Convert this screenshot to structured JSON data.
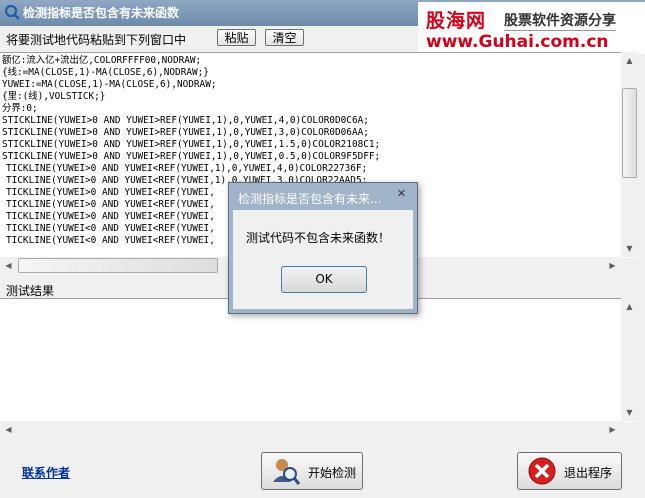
{
  "window": {
    "title": "检测指标是否包含有未来函数"
  },
  "watermark": {
    "name": "股海网",
    "tagline": "股票软件资源分享",
    "url": "www.Guhai.com.cn"
  },
  "top": {
    "paste_label": "将要测试地代码粘贴到下列窗口中",
    "paste_button": "粘贴",
    "clear_button": "清空"
  },
  "code_lines": [
    "额亿:流入亿+流出亿,COLORFFFF00,NODRAW;",
    "{线:=MA(CLOSE,1)-MA(CLOSE,6),NODRAW;}",
    "YUWEI:=MA(CLOSE,1)-MA(CLOSE,6),NODRAW;",
    "{里:(线),VOLSTICK;}",
    "分界:0;",
    "STICKLINE(YUWEI>0 AND YUWEI>REF(YUWEI,1),0,YUWEI,4,0)COLOR0D0C6A;",
    "STICKLINE(YUWEI>0 AND YUWEI>REF(YUWEI,1),0,YUWEI,3,0)COLOR0D06AA;",
    "STICKLINE(YUWEI>0 AND YUWEI>REF(YUWEI,1),0,YUWEI,1.5,0)COLOR2108C1;",
    "STICKLINE(YUWEI>0 AND YUWEI>REF(YUWEI,1),0,YUWEI,0.5,0)COLOR9F5DFF;",
    "TICKLINE(YUWEI>0 AND YUWEI<REF(YUWEI,1),0,YUWEI,4,0)COLOR22736F;",
    "TICKLINE(YUWEI>0 AND YUWEI<REF(YUWEI,1),0,YUWEI,3,0)COLOR22AAD5;",
    "TICKLINE(YUWEI>0 AND YUWEI<REF(YUWEI,",
    "TICKLINE(YUWEI>0 AND YUWEI<REF(YUWEI,",
    "TICKLINE(YUWEI>0 AND YUWEI<REF(YUWEI,",
    "TICKLINE(YUWEI<0 AND YUWEI<REF(YUWEI,",
    "TICKLINE(YUWEI<0 AND YUWEI<REF(YUWEI,"
  ],
  "results": {
    "label": "测试结果",
    "text": ""
  },
  "bottom": {
    "contact_link": "联系作者",
    "start_button": "开始检测",
    "exit_button": "退出程序"
  },
  "dialog": {
    "title": "检测指标是否包含有未来...",
    "close": "✕",
    "message": "测试代码不包含未来函数！",
    "ok": "OK"
  }
}
